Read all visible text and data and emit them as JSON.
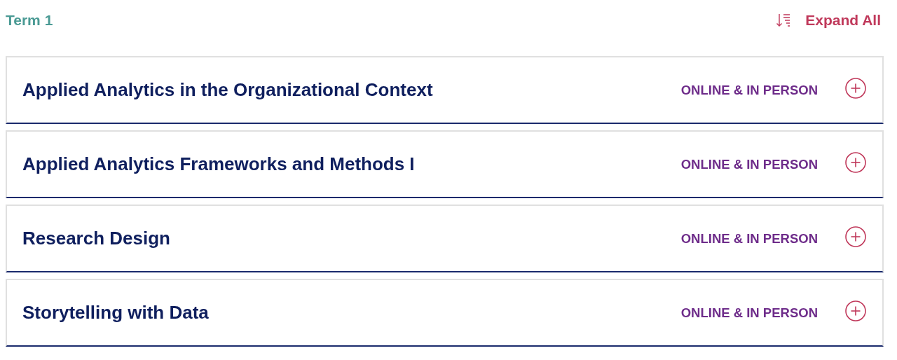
{
  "term": {
    "title": "Term 1"
  },
  "expand_all": {
    "label": "Expand All"
  },
  "courses": [
    {
      "title": "Applied Analytics in the Organizational Context",
      "mode": "ONLINE & IN PERSON",
      "expanded": false
    },
    {
      "title": "Applied Analytics Frameworks and Methods I",
      "mode": "ONLINE & IN PERSON",
      "expanded": false
    },
    {
      "title": "Research Design",
      "mode": "ONLINE & IN PERSON",
      "expanded": false
    },
    {
      "title": "Storytelling with Data",
      "mode": "ONLINE & IN PERSON",
      "expanded": false
    }
  ]
}
